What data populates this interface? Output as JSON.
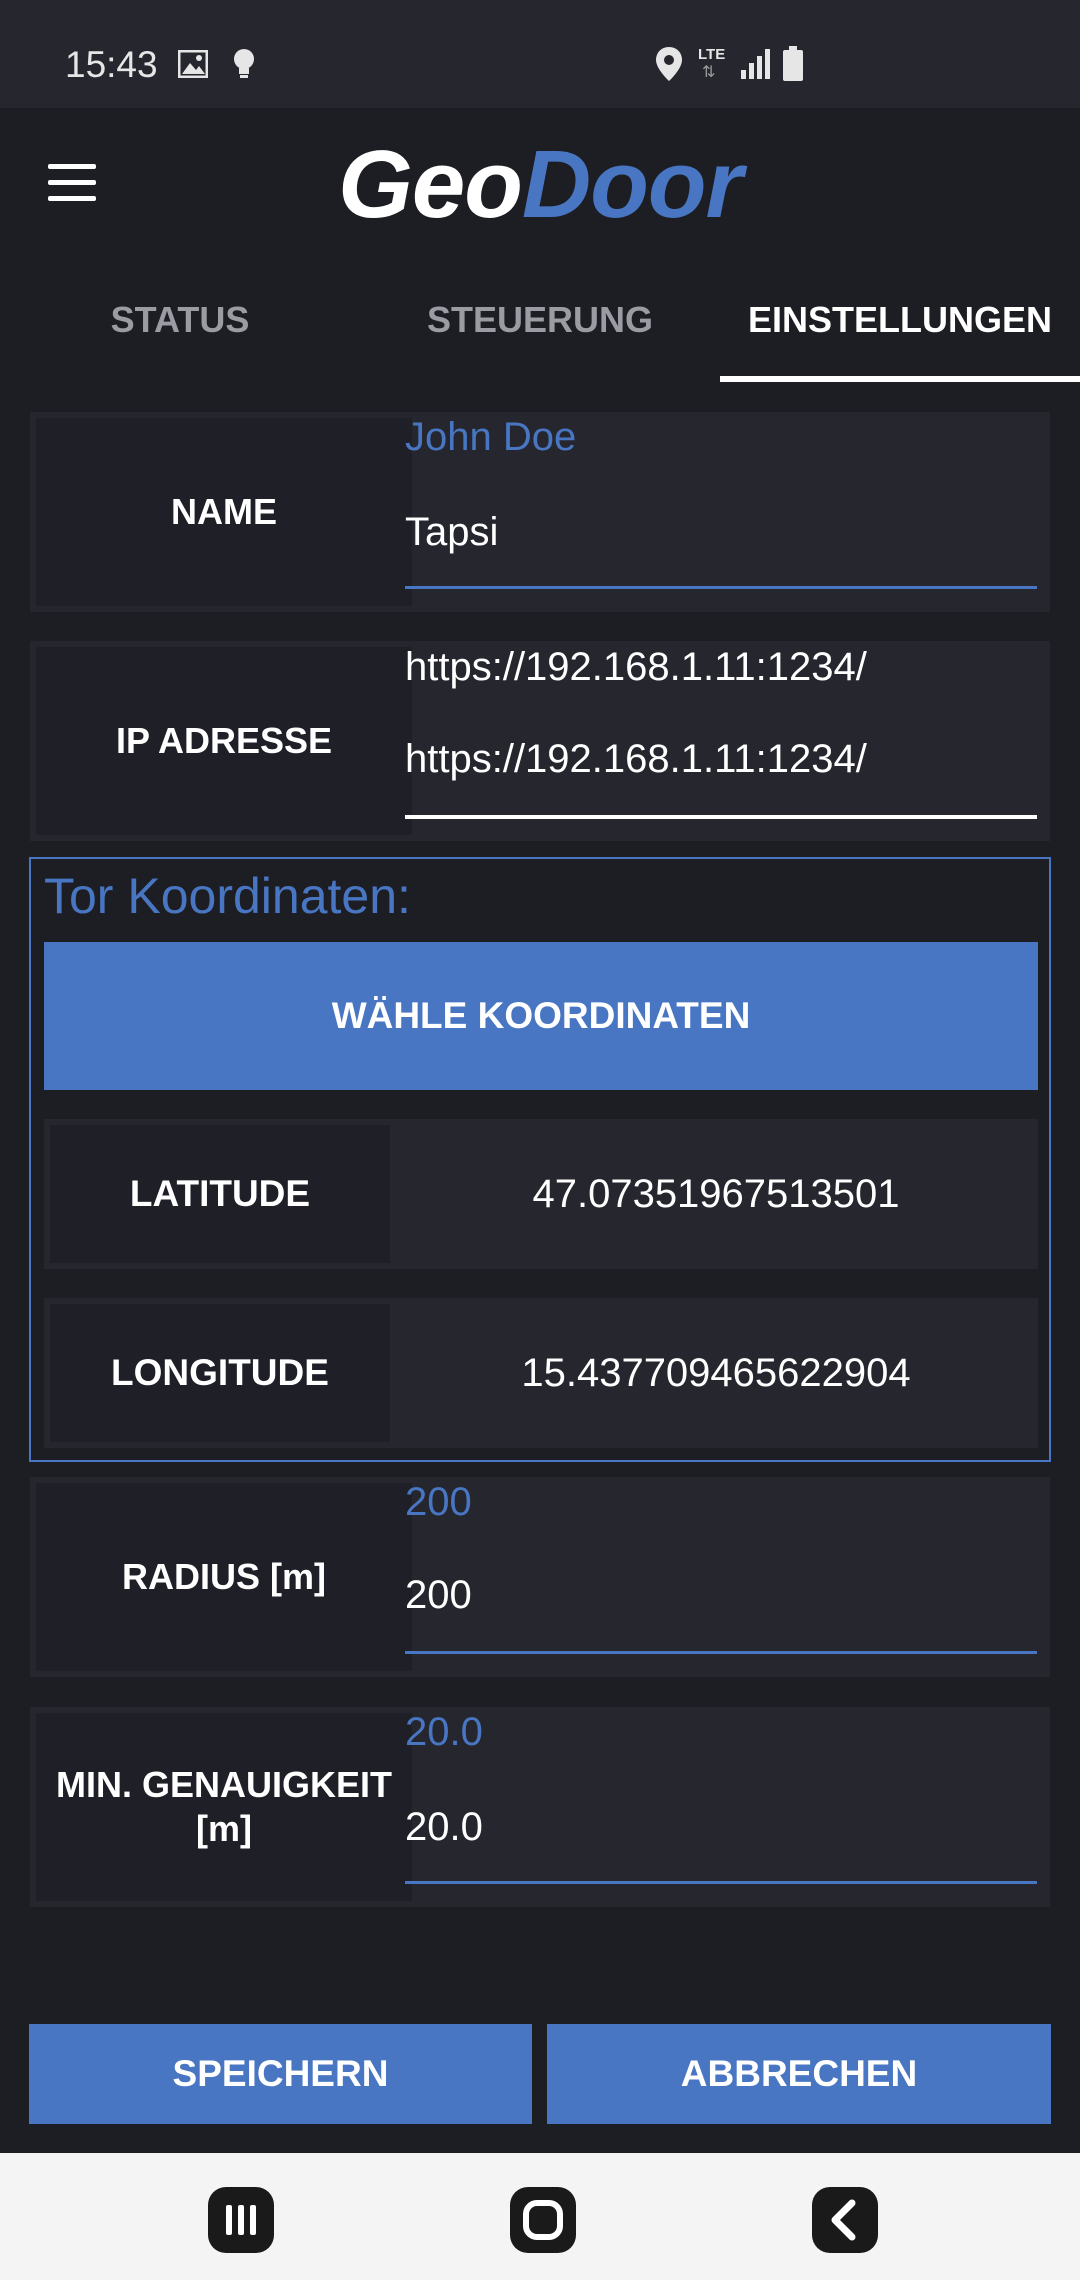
{
  "status_bar": {
    "time": "15:43",
    "icons": [
      "image-icon",
      "bulb-icon",
      "location-icon",
      "lte-icon",
      "signal-icon",
      "battery-icon"
    ],
    "lte_label": "LTE"
  },
  "app": {
    "logo_part1": "Geo",
    "logo_part2": "Door",
    "accent_color": "#4876c2",
    "background_color": "#1d1e24"
  },
  "tabs": [
    {
      "label": "STATUS",
      "active": false
    },
    {
      "label": "STEUERUNG",
      "active": false
    },
    {
      "label": "EINSTELLUNGEN",
      "active": true
    }
  ],
  "fields": {
    "name": {
      "label": "NAME",
      "hint": "John Doe",
      "value": "Tapsi"
    },
    "ip": {
      "label": "IP ADRESSE",
      "hint": "https://192.168.1.11:1234/",
      "value": "https://192.168.1.11:1234/"
    },
    "radius": {
      "label": "RADIUS [m]",
      "hint": "200",
      "value": "200"
    },
    "accuracy": {
      "label": "MIN. GENAUIGKEIT [m]",
      "hint": "20.0",
      "value": "20.0"
    }
  },
  "coordinates": {
    "title": "Tor Koordinaten:",
    "choose_button": "WÄHLE KOORDINATEN",
    "latitude_label": "LATITUDE",
    "latitude_value": "47.07351967513501",
    "longitude_label": "LONGITUDE",
    "longitude_value": "15.437709465622904"
  },
  "actions": {
    "save": "SPEICHERN",
    "cancel": "ABBRECHEN"
  },
  "nav_bar": [
    "recent-apps-icon",
    "home-icon",
    "back-icon"
  ]
}
